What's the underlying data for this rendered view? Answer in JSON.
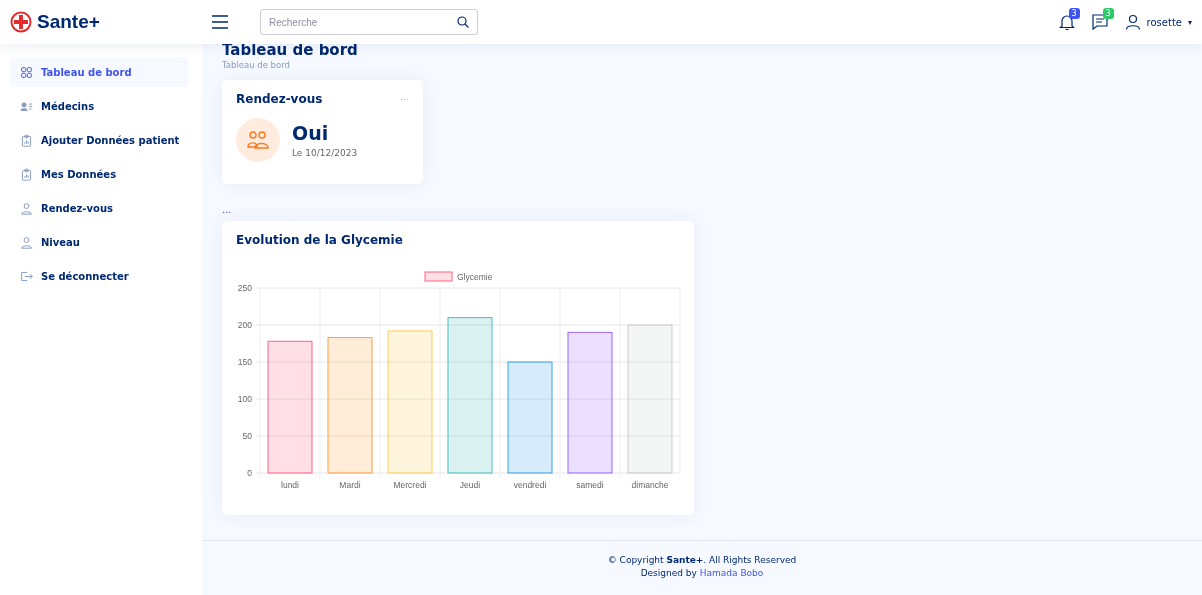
{
  "brand": {
    "name": "Sante+"
  },
  "search": {
    "placeholder": "Recherche"
  },
  "header": {
    "notifications": "3",
    "messages": "3",
    "user": "rosette",
    "caret": "▾"
  },
  "sidebar": {
    "items": [
      {
        "label": "Tableau de bord",
        "kind": "grid",
        "selected": true
      },
      {
        "label": "Médecins",
        "kind": "people",
        "selected": false
      },
      {
        "label": "Ajouter Données patient",
        "kind": "clipboard",
        "selected": false
      },
      {
        "label": "Mes Données",
        "kind": "clipboard",
        "selected": false
      },
      {
        "label": "Rendez-vous",
        "kind": "person",
        "selected": false
      },
      {
        "label": "Niveau",
        "kind": "person",
        "selected": false
      },
      {
        "label": "Se déconnecter",
        "kind": "logout",
        "selected": false
      }
    ]
  },
  "page": {
    "title": "Tableau de bord",
    "breadcrumb": "Tableau de bord"
  },
  "appointment_card": {
    "title": "Rendez-vous",
    "menu": "...",
    "value": "Oui",
    "date": "Le 10/12/2023"
  },
  "section_menu": "...",
  "glycemia_card": {
    "title": "Evolution de la Glycemie",
    "chart_data": {
      "type": "bar",
      "categories": [
        "lundi",
        "Mardi",
        "Mercredi",
        "Jeudi",
        "vendredi",
        "samedi",
        "dimanche"
      ],
      "series": [
        {
          "name": "Glycemie",
          "values": [
            178,
            183,
            192,
            210,
            150,
            190,
            200
          ]
        }
      ],
      "grid": true,
      "colors": [
        "#ff6384",
        "#ff9f40",
        "#ffcd56",
        "#4bc0c0",
        "#36a2eb",
        "#9966ff",
        "#c9cbcf"
      ],
      "ylim": [
        0,
        250
      ],
      "yticks": [
        0,
        50,
        100,
        150,
        200,
        250
      ]
    }
  },
  "footer": {
    "copyright": "© Copyright **Sante+**. All Rights Reserved",
    "designed_by": "Designed by",
    "author": "Hamada Bobo"
  }
}
